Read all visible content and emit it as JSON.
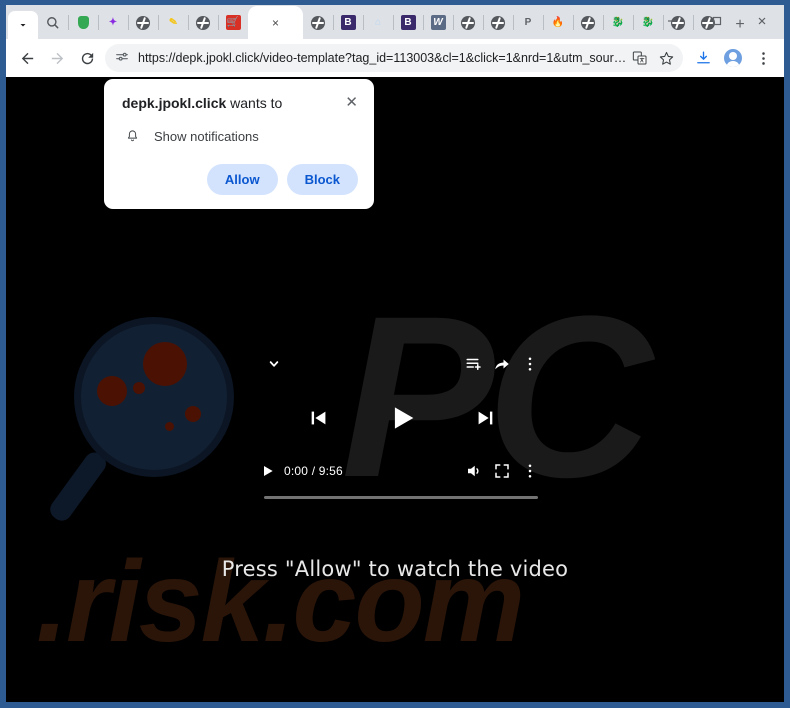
{
  "window": {
    "minimize_label": "—",
    "maximize_label": "☐",
    "close_label": "✕",
    "frame_color": "#2e5c92"
  },
  "tabstrip": {
    "tab_search_icon": "chevron-down-icon",
    "new_tab_label": "+",
    "active_tab": {
      "close_label": "×",
      "title": ""
    },
    "tabs": [
      {
        "favicon": "search-globe-icon",
        "kind": "fi-search-g"
      },
      {
        "favicon": "shield-icon",
        "kind": "fi-shield"
      },
      {
        "favicon": "bolt-icon",
        "kind": "fi-bolt",
        "glyph": "⚡"
      },
      {
        "favicon": "globe-icon",
        "kind": "fi-globe"
      },
      {
        "favicon": "pencil-icon",
        "kind": "fi-pencil",
        "glyph": "✎"
      },
      {
        "favicon": "globe-icon",
        "kind": "fi-globe"
      },
      {
        "favicon": "cart-icon",
        "kind": "fi-cart",
        "glyph": "⛟"
      }
    ],
    "tabs_after": [
      {
        "favicon": "globe-icon",
        "kind": "fi-globe"
      },
      {
        "favicon": "bitdefender-icon",
        "kind": "fi-b",
        "glyph": "B"
      },
      {
        "favicon": "house-icon",
        "kind": "fi-house",
        "glyph": "⌂"
      },
      {
        "favicon": "bitdefender-icon",
        "kind": "fi-b",
        "glyph": "B"
      },
      {
        "favicon": "wordpress-icon",
        "kind": "fi-wp",
        "glyph": "W"
      },
      {
        "favicon": "globe-icon",
        "kind": "fi-globe"
      },
      {
        "favicon": "globe-icon",
        "kind": "fi-globe"
      },
      {
        "favicon": "p-letter-icon",
        "kind": "fi-p",
        "glyph": "P"
      },
      {
        "favicon": "flame-icon",
        "kind": "fi-flame",
        "glyph": "🔥"
      },
      {
        "favicon": "globe-icon",
        "kind": "fi-globe"
      },
      {
        "favicon": "dragon-icon",
        "kind": "fi-dragon",
        "glyph": "🐉"
      },
      {
        "favicon": "dragon-icon",
        "kind": "fi-dragon",
        "glyph": "🐉"
      },
      {
        "favicon": "globe-icon",
        "kind": "fi-globe"
      },
      {
        "favicon": "globe-icon",
        "kind": "fi-globe"
      }
    ]
  },
  "toolbar": {
    "back_label": "Back",
    "forward_label": "Forward",
    "reload_label": "Reload",
    "site_info_icon": "tune-settings-icon",
    "url": "https://depk.jpokl.click/video-template?tag_id=113003&cl=1&click=1&nrd=1&utm_source…",
    "translate_icon": "translate-icon",
    "bookmark_icon": "star-icon",
    "download_icon": "download-icon",
    "profile_icon": "avatar-icon",
    "menu_icon": "three-dots-vertical-icon"
  },
  "permission_dialog": {
    "origin": "depk.jpokl.click",
    "headline_suffix": " wants to",
    "close_label": "✕",
    "request_icon": "bell-icon",
    "request_label": "Show notifications",
    "allow_label": "Allow",
    "block_label": "Block",
    "button_bg": "#d3e3fd",
    "button_fg": "#0b57d0"
  },
  "page": {
    "watermark_logo": "PC",
    "watermark_domain": ".risk.com",
    "headline": "Press \"Allow\" to watch the video",
    "magnifier_icon": "magnifier-icon"
  },
  "player": {
    "collapse_icon": "chevron-down-icon",
    "queue_icon": "add-to-queue-icon",
    "share_icon": "share-arrow-icon",
    "overflow_icon": "three-dots-vertical-icon",
    "previous_icon": "skip-previous-icon",
    "play_icon": "play-icon",
    "next_icon": "skip-next-icon",
    "small_play_icon": "play-icon",
    "time": "0:00 / 9:56",
    "current_time": "0:00",
    "duration": "9:56",
    "volume_icon": "volume-up-icon",
    "fullscreen_icon": "fullscreen-icon",
    "settings_icon": "three-dots-vertical-icon",
    "progress_percent": 0
  }
}
